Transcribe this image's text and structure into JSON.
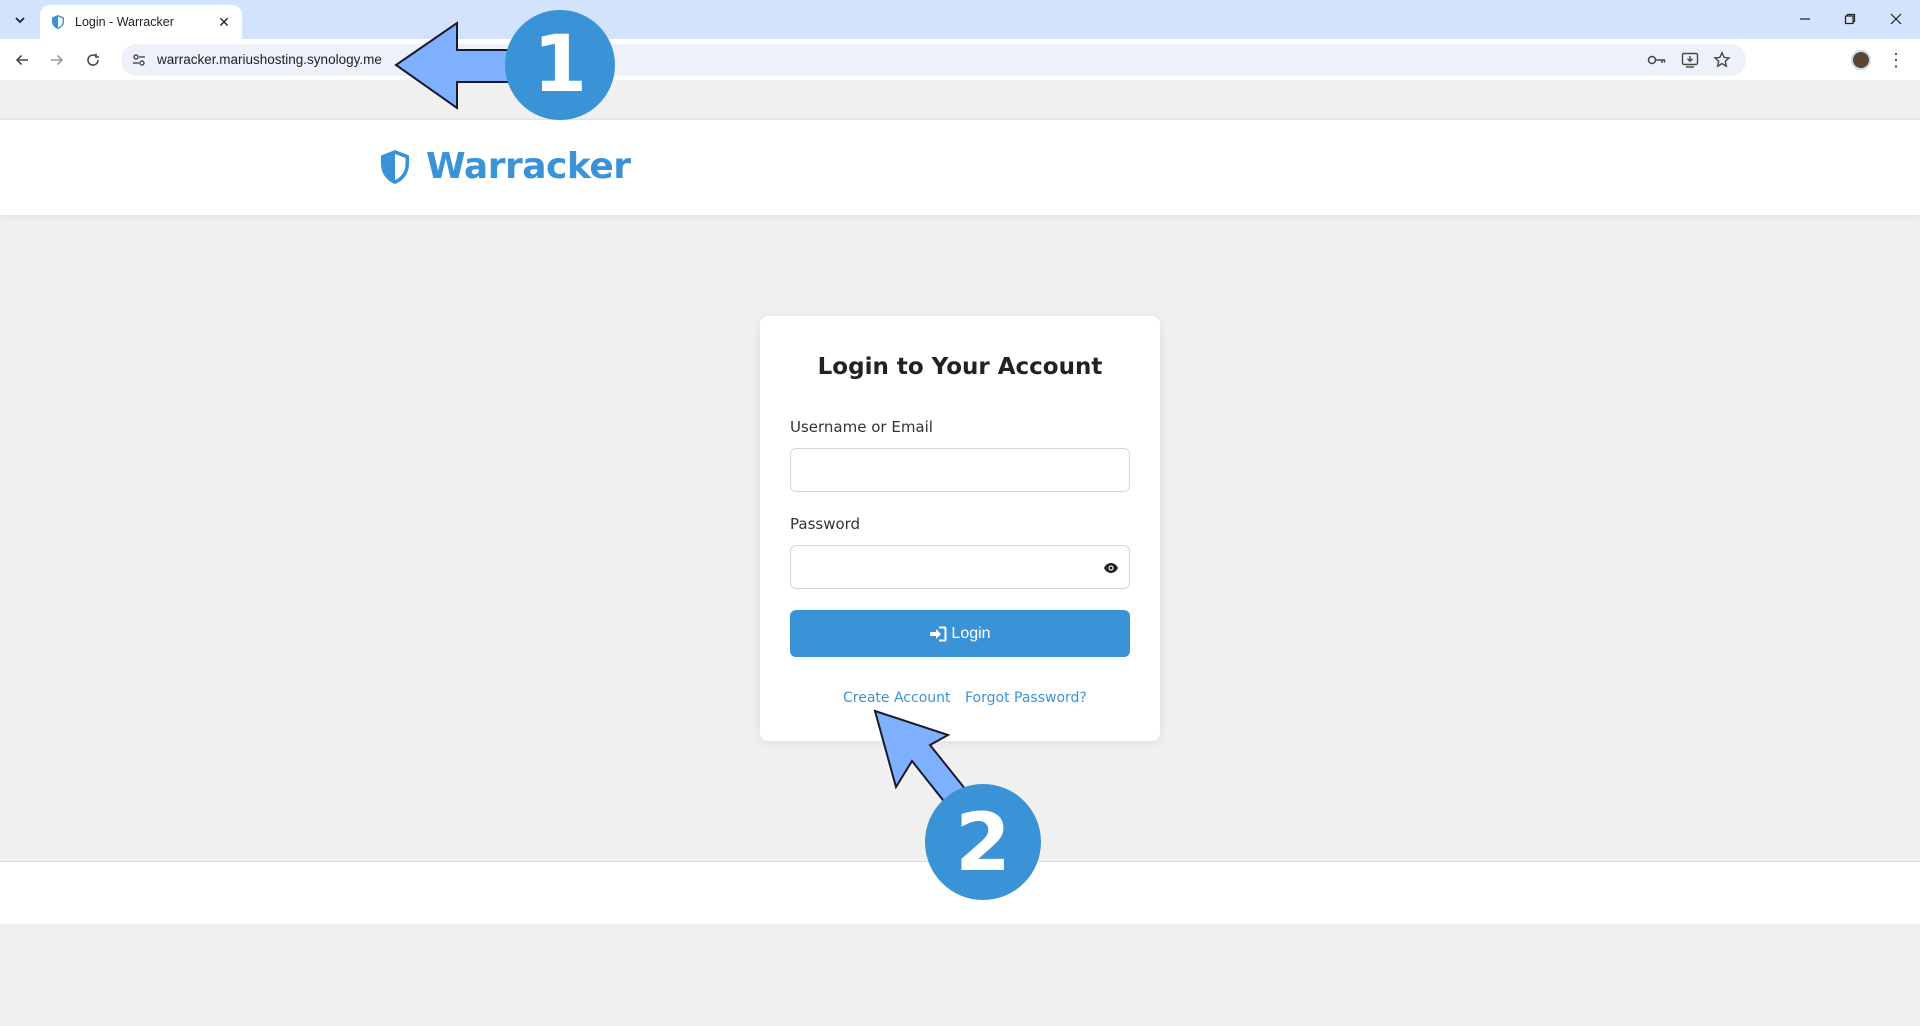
{
  "browser": {
    "tab": {
      "title": "Login - Warracker",
      "favicon": "shield-icon"
    },
    "url": "warracker.mariushosting.synology.me",
    "colors": {
      "tabstrip": "#d3e3fd",
      "omnibox": "#edf2fa"
    }
  },
  "site": {
    "brand_name": "Warracker",
    "brand_color": "#3a93d7"
  },
  "login": {
    "title": "Login to Your Account",
    "username_label": "Username or Email",
    "username_value": "",
    "password_label": "Password",
    "password_value": "",
    "login_button": "Login",
    "create_account_link": "Create Account",
    "forgot_password_link": "Forgot Password?"
  },
  "annotations": {
    "badge_1": "1",
    "badge_2": "2",
    "arrow_color": "#7fb0ff"
  }
}
